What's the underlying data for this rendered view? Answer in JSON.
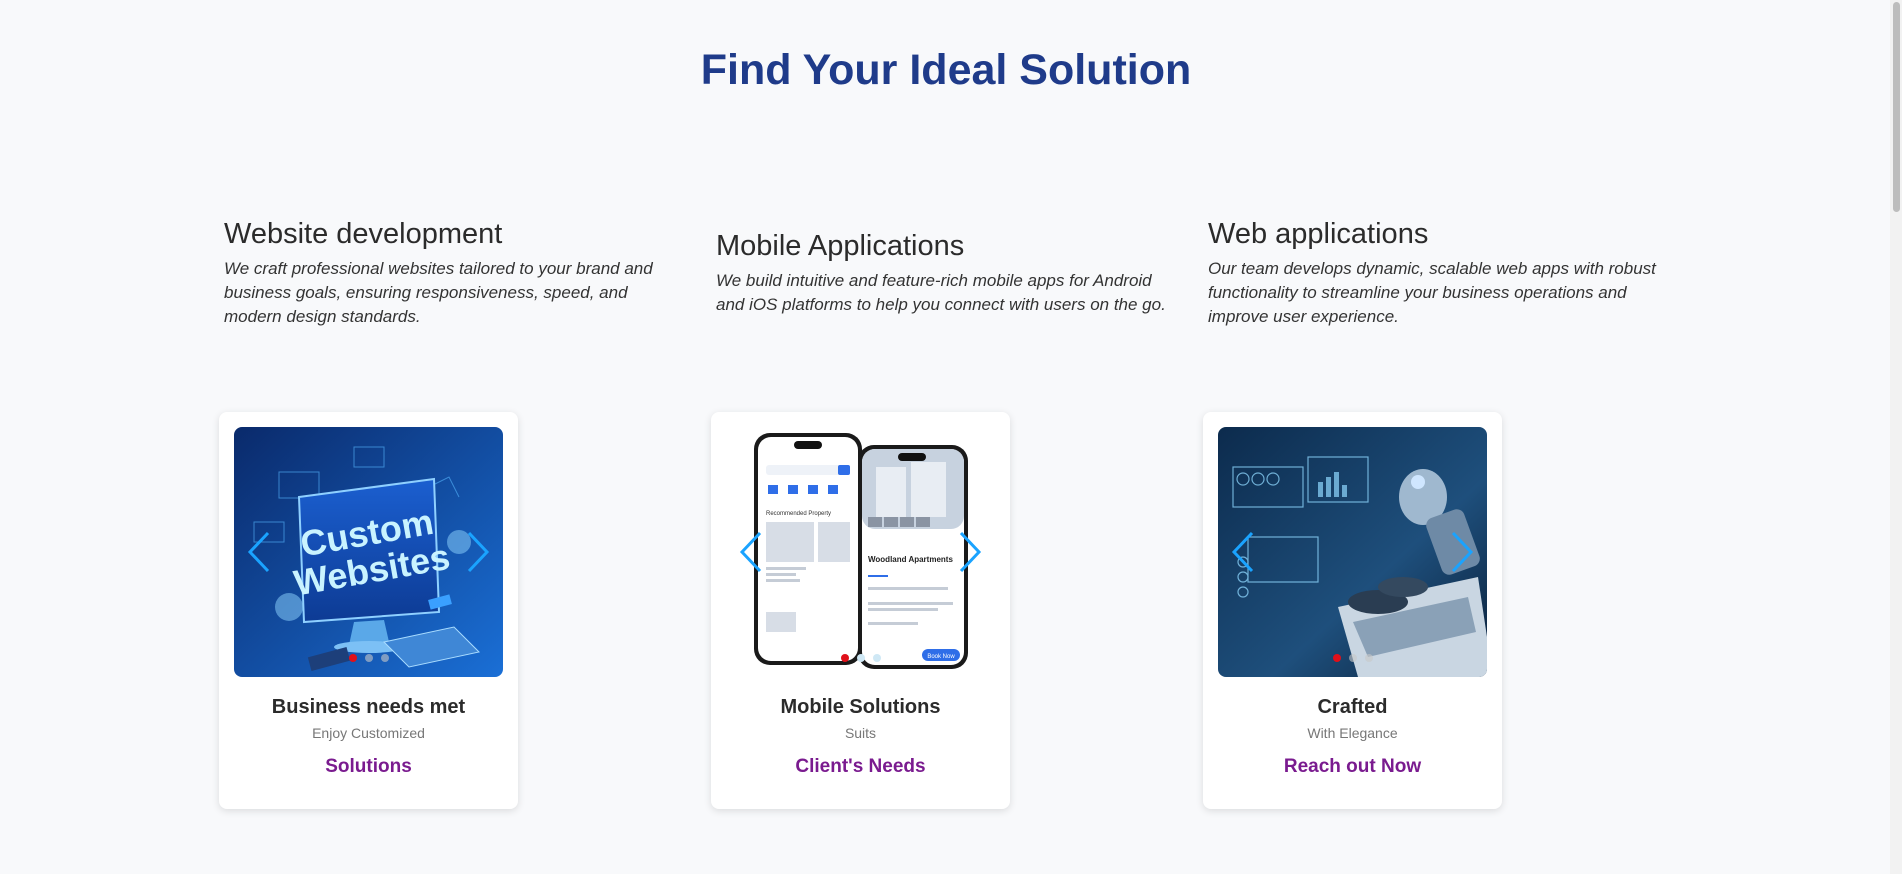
{
  "page": {
    "title": "Find Your Ideal Solution"
  },
  "services": [
    {
      "title": "Website development",
      "description": "We craft professional websites tailored to your brand and business goals, ensuring responsiveness, speed, and modern design standards."
    },
    {
      "title": "Mobile Applications",
      "description": "We build intuitive and feature-rich mobile apps for Android and iOS platforms to help you connect with users on the go."
    },
    {
      "title": "Web applications",
      "description": "Our team develops dynamic, scalable web apps with robust functionality to streamline your business operations and improve user experience."
    }
  ],
  "cards": [
    {
      "title": "Business needs met",
      "subtitle": "Enjoy Customized",
      "link": "Solutions",
      "image_text": [
        "Custom",
        "Websites"
      ]
    },
    {
      "title": "Mobile Solutions",
      "subtitle": "Suits",
      "link": "Client's Needs",
      "phone_text": "Woodland Apartments",
      "phone_button": "Book Now",
      "phone_section": "Recommended Property"
    },
    {
      "title": "Crafted",
      "subtitle": "With Elegance",
      "link": "Reach out Now"
    }
  ],
  "colors": {
    "title": "#1f3b8a",
    "link": "#7a1b8f",
    "arrow": "#1aa3ff",
    "active_dot": "#e0101a"
  },
  "icons": [
    "chevron-left-icon",
    "chevron-right-icon"
  ]
}
